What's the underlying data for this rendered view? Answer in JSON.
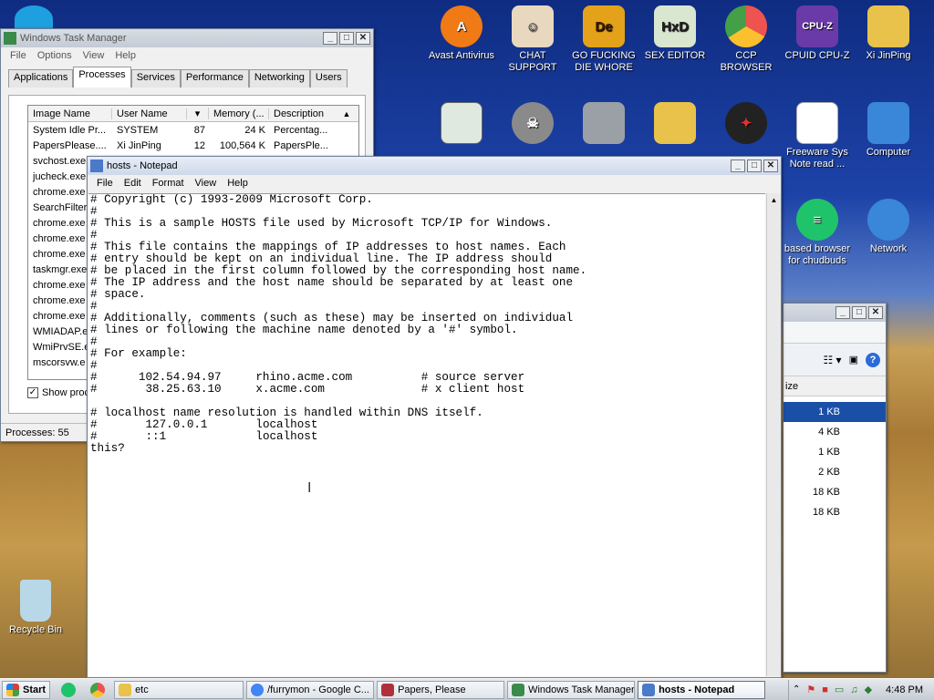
{
  "desktop": {
    "icons": [
      {
        "label": "Avast Antivirus",
        "color": "#f07a16"
      },
      {
        "label": "CHAT SUPPORT",
        "color": "#e8d8c0"
      },
      {
        "label": "GO FUCKING DIE WHORE",
        "color": "#e3a21a"
      },
      {
        "label": "SEX EDITOR",
        "color": "#d9e6d0"
      },
      {
        "label": "CCP BROWSER",
        "color": "#ef5350"
      },
      {
        "label": "CPUID CPU-Z",
        "color": "#6a3aa8"
      },
      {
        "label": "Xi JinPing",
        "color": "#e8c24a"
      },
      {
        "label": "Freeware Sys Note read ...",
        "color": "#ffffff"
      },
      {
        "label": "Computer",
        "color": "#3a86d8"
      },
      {
        "label": "based browser for chudbuds",
        "color": "#1fc46a"
      },
      {
        "label": "Network",
        "color": "#3a86d8"
      },
      {
        "label": "Recycle Bin",
        "color": "#b8d8e8"
      }
    ]
  },
  "task_manager": {
    "title": "Windows Task Manager",
    "menu": [
      "File",
      "Options",
      "View",
      "Help"
    ],
    "tabs": [
      "Applications",
      "Processes",
      "Services",
      "Performance",
      "Networking",
      "Users"
    ],
    "active_tab": "Processes",
    "columns": [
      "Image Name",
      "User Name",
      "Memory (...",
      "Description"
    ],
    "rows": [
      {
        "image": "System Idle Pr...",
        "user": "SYSTEM",
        "cpu": "87",
        "mem": "24 K",
        "desc": "Percentag..."
      },
      {
        "image": "PapersPlease....",
        "user": "Xi JinPing",
        "cpu": "12",
        "mem": "100,564 K",
        "desc": "PapersPle..."
      },
      {
        "image": "svchost.exe"
      },
      {
        "image": "jucheck.exe"
      },
      {
        "image": "chrome.exe"
      },
      {
        "image": "SearchFilter"
      },
      {
        "image": "chrome.exe"
      },
      {
        "image": "chrome.exe"
      },
      {
        "image": "chrome.exe"
      },
      {
        "image": "taskmgr.exe"
      },
      {
        "image": "chrome.exe"
      },
      {
        "image": "chrome.exe"
      },
      {
        "image": "chrome.exe"
      },
      {
        "image": "WMIADAP.e"
      },
      {
        "image": "WmiPrvSE.e"
      },
      {
        "image": "mscorsvw.e"
      }
    ],
    "show_processes_label": "Show proc",
    "status": "Processes: 55"
  },
  "notepad": {
    "title": "hosts - Notepad",
    "menu": [
      "File",
      "Edit",
      "Format",
      "View",
      "Help"
    ],
    "content": "# Copyright (c) 1993-2009 Microsoft Corp.\n#\n# This is a sample HOSTS file used by Microsoft TCP/IP for Windows.\n#\n# This file contains the mappings of IP addresses to host names. Each\n# entry should be kept on an individual line. The IP address should\n# be placed in the first column followed by the corresponding host name.\n# The IP address and the host name should be separated by at least one\n# space.\n#\n# Additionally, comments (such as these) may be inserted on individual\n# lines or following the machine name denoted by a '#' symbol.\n#\n# For example:\n#\n#      102.54.94.97     rhino.acme.com          # source server\n#       38.25.63.10     x.acme.com              # x client host\n\n# localhost name resolution is handled within DNS itself.\n#\t127.0.0.1       localhost\n#\t::1             localhost\nthis?"
  },
  "explorer": {
    "column": "ize",
    "sizes": [
      "1 KB",
      "4 KB",
      "1 KB",
      "2 KB",
      "18 KB",
      "18 KB"
    ]
  },
  "taskbar": {
    "start": "Start",
    "items": [
      {
        "label": "etc",
        "color": "#e8c24a"
      },
      {
        "label": "/furrymon - Google C...",
        "color": "#4285f4"
      },
      {
        "label": "Papers, Please",
        "color": "#b0303a"
      },
      {
        "label": "Windows Task Manager",
        "color": "#3a8a4a"
      },
      {
        "label": "hosts - Notepad",
        "color": "#4a7ac8"
      }
    ],
    "clock": "4:48 PM"
  }
}
